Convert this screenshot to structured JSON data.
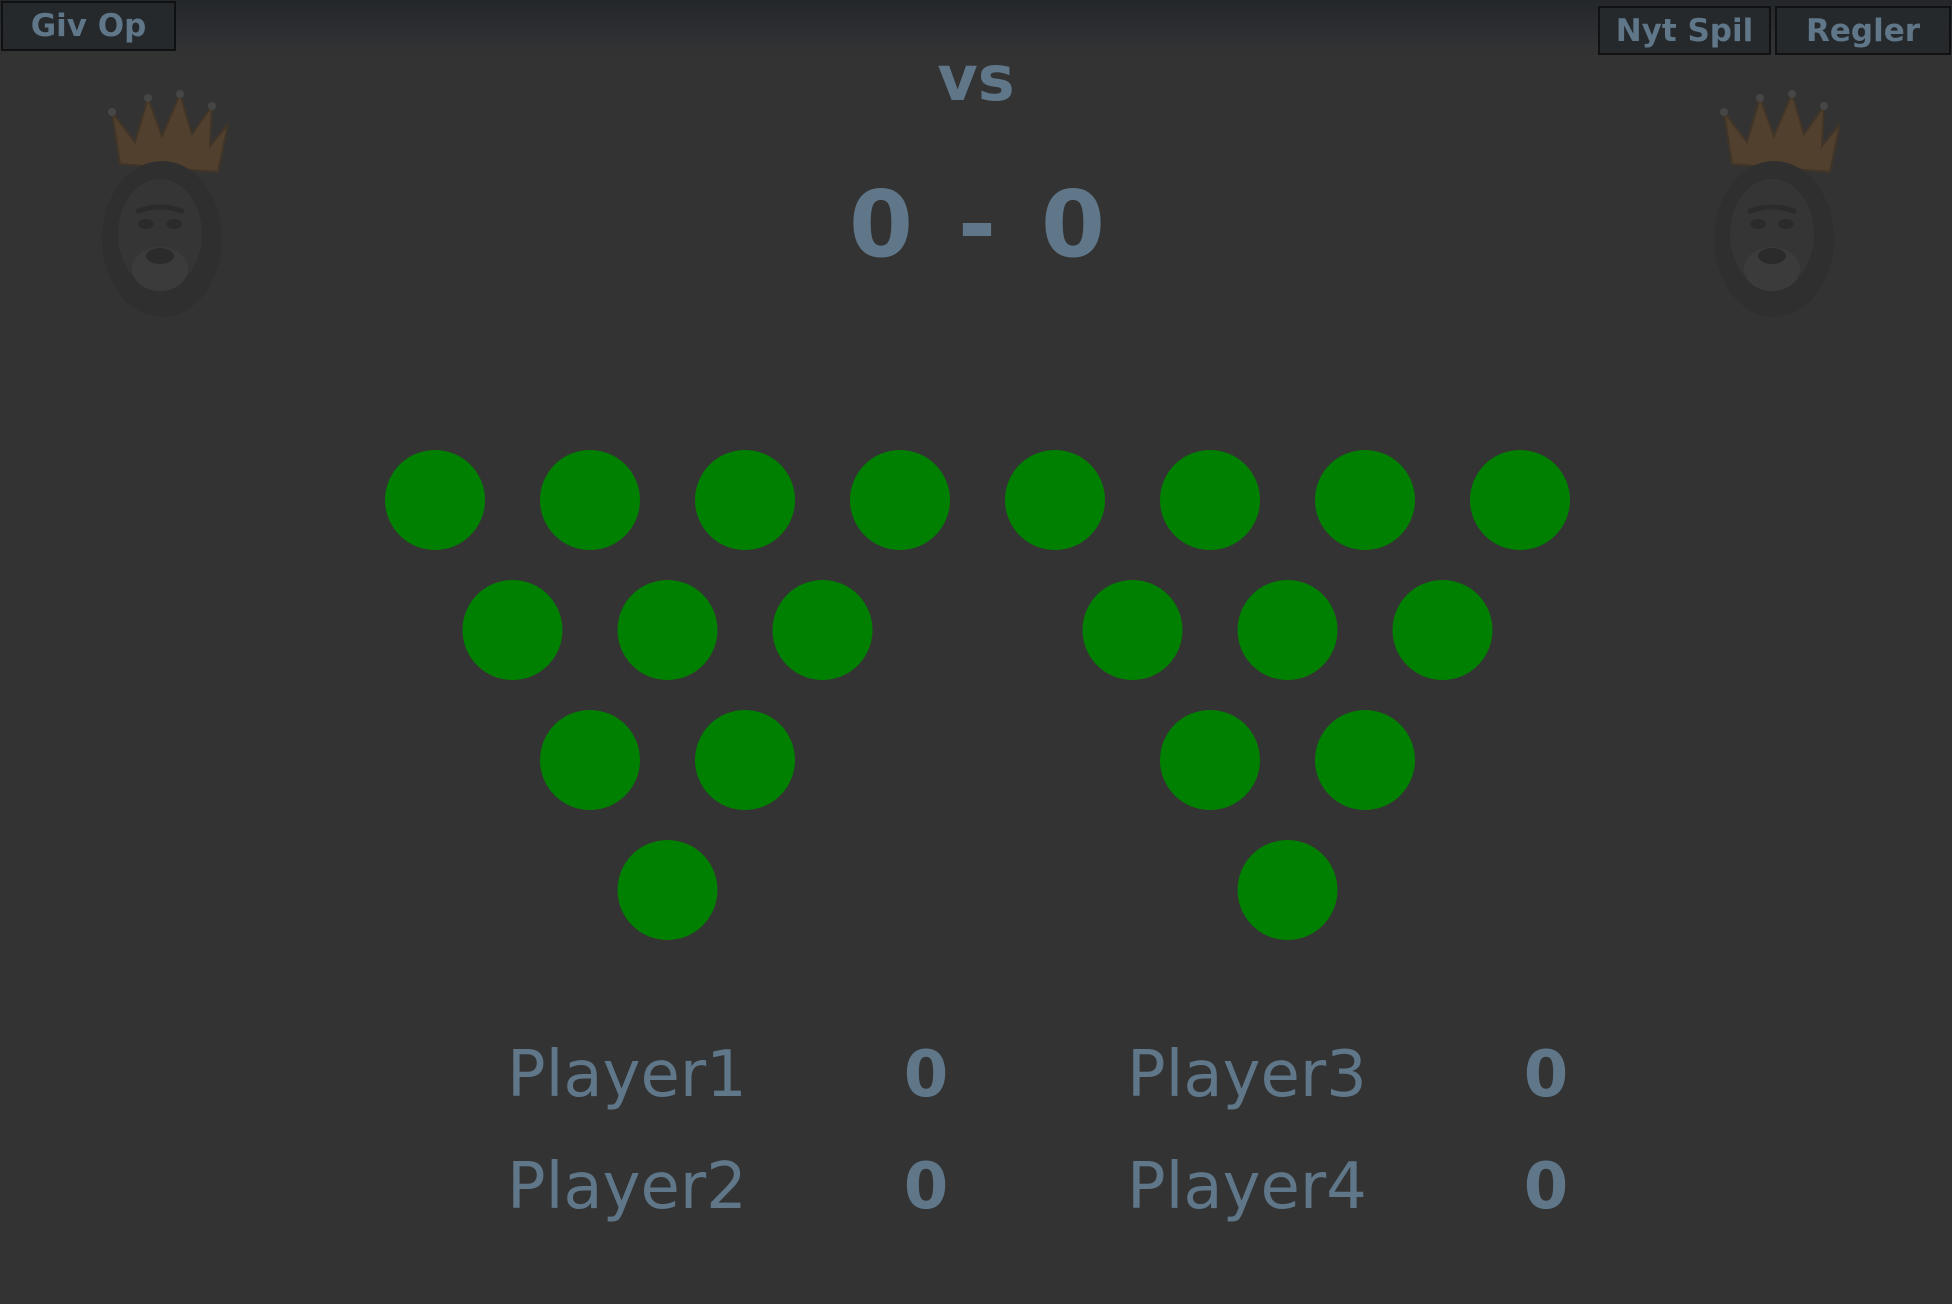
{
  "toolbar": {
    "give_up_label": "Giv Op",
    "new_game_label": "Nyt Spil",
    "rules_label": "Regler"
  },
  "match": {
    "vs_label": "vs",
    "team_left_score": "0",
    "separator": "-",
    "team_right_score": "0"
  },
  "mascots": {
    "left_icon": "crowned-gorilla-icon",
    "right_icon": "crowned-gorilla-icon"
  },
  "cups": {
    "color": "#008000",
    "racks": [
      {
        "name": "left-rack",
        "rows": [
          4,
          3,
          2,
          1
        ]
      },
      {
        "name": "right-rack",
        "rows": [
          4,
          3,
          2,
          1
        ]
      }
    ]
  },
  "players": [
    {
      "name": "Player1",
      "score": "0"
    },
    {
      "name": "Player2",
      "score": "0"
    },
    {
      "name": "Player3",
      "score": "0"
    },
    {
      "name": "Player4",
      "score": "0"
    }
  ],
  "colors": {
    "background": "#333333",
    "text": "#5f7789",
    "button_bg": "#26292c",
    "cup": "#008000"
  }
}
